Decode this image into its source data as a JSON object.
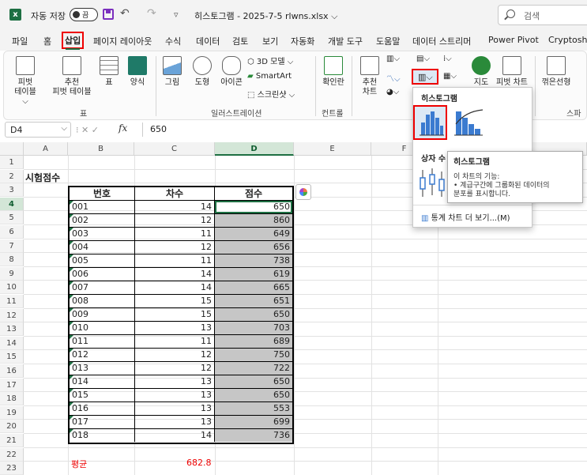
{
  "titlebar": {
    "app_badge": "x",
    "autosave_label": "자동 저장",
    "autosave_state": "끔",
    "undo_glyph": "↶",
    "redo_glyph": "↷",
    "customize_glyph": "▿",
    "doc_title": "히스토그램 - 2025-7-5 rlwns.xlsx ⌵",
    "search_placeholder": "검색"
  },
  "tabs": [
    "파일",
    "홈",
    "삽입",
    "페이지 레이아웃",
    "수식",
    "데이터",
    "검토",
    "보기",
    "자동화",
    "개발 도구",
    "도움말",
    "데이터 스트리머",
    "Power Pivot",
    "Cryptoshe"
  ],
  "active_tab": "삽입",
  "ribbon": {
    "pivot_table": [
      "피벗",
      "테이블 ⌵"
    ],
    "recommended_pivot": [
      "추천",
      "피벗 테이블"
    ],
    "table": "표",
    "forms": "양식",
    "group_table": "표",
    "picture": "그림",
    "shapes": "도형",
    "icons": "아이콘",
    "model_3d": "3D 모델",
    "smartart": "SmartArt",
    "screenshot": "스크린샷",
    "group_illustrations": "일러스트레이션",
    "checkbox": "확인란",
    "group_controls": "컨트롤",
    "recommended_charts": [
      "추천",
      "차트"
    ],
    "maps": "지도",
    "pivot_chart": "피벗 차트",
    "sparkline_line": "꺾은선형",
    "group_sparklines": "스파크"
  },
  "formula_bar": {
    "name_box": "D4",
    "formula_value": "650"
  },
  "columns": [
    "A",
    "B",
    "C",
    "D",
    "E",
    "F"
  ],
  "rows": [
    "1",
    "2",
    "3",
    "4",
    "5",
    "6",
    "7",
    "8",
    "9",
    "10",
    "11",
    "12",
    "13",
    "14",
    "15",
    "16",
    "17",
    "18",
    "19",
    "20",
    "21",
    "22",
    "23"
  ],
  "sheet": {
    "title": "시험점수",
    "headers": [
      "번호",
      "차수",
      "점수"
    ],
    "records": [
      {
        "num": "001",
        "round": "14",
        "score": "650"
      },
      {
        "num": "002",
        "round": "12",
        "score": "860"
      },
      {
        "num": "003",
        "round": "11",
        "score": "649"
      },
      {
        "num": "004",
        "round": "12",
        "score": "656"
      },
      {
        "num": "005",
        "round": "11",
        "score": "738"
      },
      {
        "num": "006",
        "round": "14",
        "score": "619"
      },
      {
        "num": "007",
        "round": "14",
        "score": "665"
      },
      {
        "num": "008",
        "round": "15",
        "score": "651"
      },
      {
        "num": "009",
        "round": "15",
        "score": "650"
      },
      {
        "num": "010",
        "round": "13",
        "score": "703"
      },
      {
        "num": "011",
        "round": "11",
        "score": "689"
      },
      {
        "num": "012",
        "round": "12",
        "score": "750"
      },
      {
        "num": "013",
        "round": "12",
        "score": "722"
      },
      {
        "num": "014",
        "round": "13",
        "score": "650"
      },
      {
        "num": "015",
        "round": "13",
        "score": "650"
      },
      {
        "num": "016",
        "round": "13",
        "score": "553"
      },
      {
        "num": "017",
        "round": "13",
        "score": "699"
      },
      {
        "num": "018",
        "round": "14",
        "score": "736"
      }
    ],
    "avg_label": "평균",
    "avg_value": "682.8"
  },
  "dropdown": {
    "heading": "히스토그램",
    "sub_heading": "상자 수",
    "more_charts": "통계 차트 더 보기...(M)"
  },
  "tooltip": {
    "title": "히스토그램",
    "line1": "이 차트의 기능:",
    "line2": "• 계급구간에 그룹화된 데이터의",
    "line3": "분포를 표시합니다."
  },
  "colors": {
    "excel_green": "#1d6f42",
    "highlight_red": "#e00000",
    "selected_fill": "#c6c6c6"
  }
}
